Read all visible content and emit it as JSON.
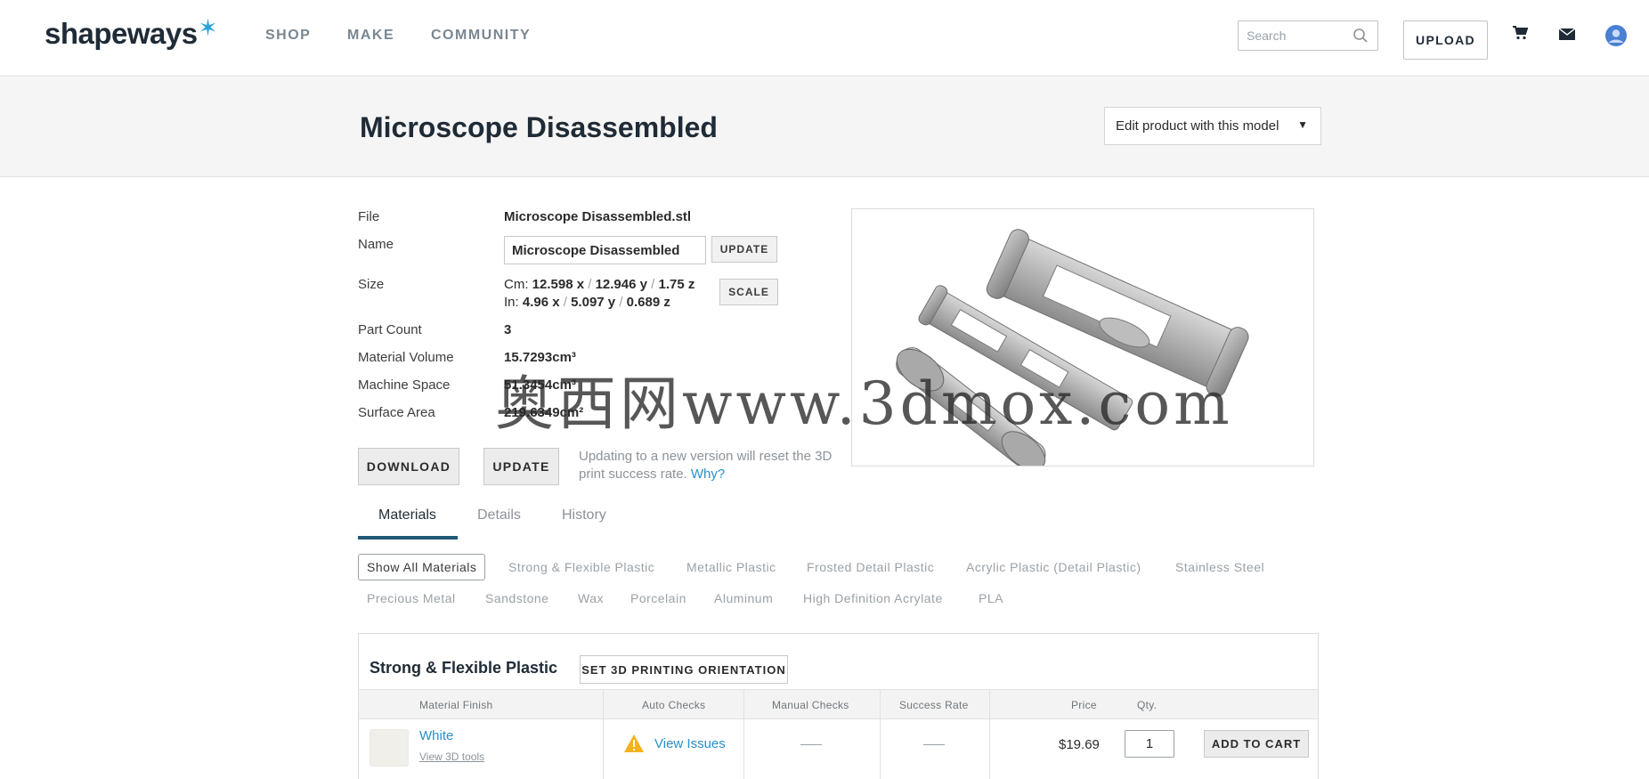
{
  "header": {
    "logo": "shapeways",
    "logo_mark": "✶",
    "nav": [
      "SHOP",
      "MAKE",
      "COMMUNITY"
    ],
    "search_placeholder": "Search",
    "upload_label": "UPLOAD",
    "icons": [
      "cart-icon",
      "mail-icon",
      "account-icon"
    ]
  },
  "title_band": {
    "title": "Microscope Disassembled",
    "edit_select": "Edit product with this model"
  },
  "model_info": {
    "file_label": "File",
    "file_value": "Microscope Disassembled.stl",
    "name_label": "Name",
    "name_value": "Microscope Disassembled",
    "name_update": "UPDATE",
    "size_label": "Size",
    "size_cm_prefix": "Cm:",
    "size_cm_x": "12.598 x",
    "size_cm_y": "12.946 y",
    "size_cm_z": "1.75 z",
    "size_in_prefix": "In:",
    "size_in_x": "4.96 x",
    "size_in_y": "5.097 y",
    "size_in_z": "0.689 z",
    "scale_label": "SCALE",
    "part_count_label": "Part Count",
    "part_count_value": "3",
    "material_volume_label": "Material Volume",
    "material_volume_value": "15.7293cm³",
    "machine_space_label": "Machine Space",
    "machine_space_value": "51.3454cm³",
    "surface_area_label": "Surface Area",
    "surface_area_value": "219.6349cm²"
  },
  "actions": {
    "download": "DOWNLOAD",
    "update": "UPDATE",
    "note": "Updating to a new version will reset the 3D print success rate.",
    "why": "Why?"
  },
  "watermark": "奥西网www.3dmox.com",
  "tabs": [
    "Materials",
    "Details",
    "History"
  ],
  "material_filters": {
    "row1": [
      "Show All Materials",
      "Strong & Flexible Plastic",
      "Metallic Plastic",
      "Frosted Detail Plastic",
      "Acrylic Plastic (Detail Plastic)",
      "Stainless Steel"
    ],
    "row2": [
      "Precious Metal",
      "Sandstone",
      "Wax",
      "Porcelain",
      "Aluminum",
      "High Definition Acrylate",
      "PLA"
    ]
  },
  "material_table": {
    "title": "Strong & Flexible Plastic",
    "orientation_btn": "SET 3D PRINTING ORIENTATION",
    "headers": [
      "Material Finish",
      "Auto Checks",
      "Manual Checks",
      "Success Rate",
      "Price",
      "Qty."
    ],
    "rows": [
      {
        "finish": "White",
        "tools_link": "View 3D tools",
        "auto_checks": "View Issues",
        "manual_checks": "—",
        "success_rate": "—",
        "price": "$19.69",
        "qty": "1",
        "add_to_cart": "ADD TO CART"
      }
    ]
  }
}
